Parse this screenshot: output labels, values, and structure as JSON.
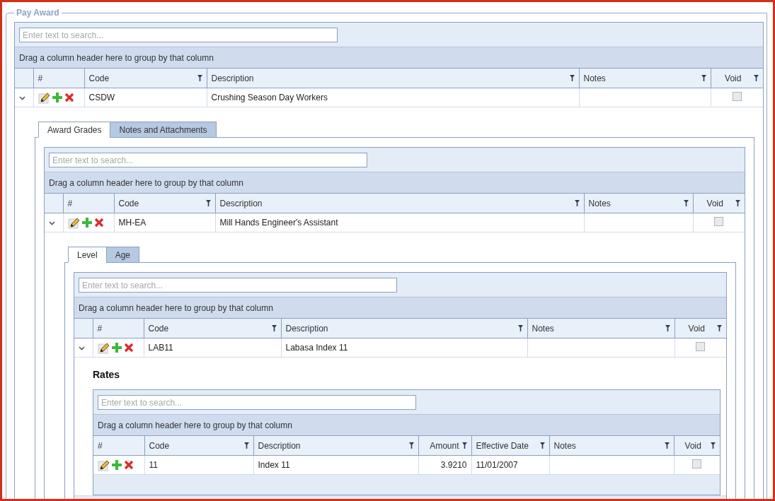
{
  "panel": {
    "legend": "Pay Award",
    "grid": {
      "search_placeholder": "Enter text to search...",
      "group_panel": "Drag a column header here to group by that column",
      "expandable": true,
      "columns": [
        {
          "label": "#",
          "kind": "actions",
          "filter": false
        },
        {
          "label": "Code",
          "kind": "text",
          "filter": true
        },
        {
          "label": "Description",
          "kind": "text",
          "filter": true
        },
        {
          "label": "Notes",
          "kind": "text",
          "filter": true
        },
        {
          "label": "Void",
          "kind": "checkbox",
          "filter": true
        }
      ],
      "rows": [
        {
          "expanded": true,
          "cells": [
            null,
            "CSDW",
            "Crushing Season Day Workers",
            null,
            {
              "checked": false
            }
          ],
          "detail": {
            "tabs": [
              {
                "label": "Award Grades",
                "selected": true
              },
              {
                "label": "Notes and Attachments",
                "selected": false
              }
            ],
            "grid": {
              "search_placeholder": "Enter text to search...",
              "group_panel": "Drag a column header here to group by that column",
              "expandable": true,
              "columns": [
                {
                  "label": "#",
                  "kind": "actions",
                  "filter": false
                },
                {
                  "label": "Code",
                  "kind": "text",
                  "filter": true
                },
                {
                  "label": "Description",
                  "kind": "text",
                  "filter": true
                },
                {
                  "label": "Notes",
                  "kind": "text",
                  "filter": true
                },
                {
                  "label": "Void",
                  "kind": "checkbox",
                  "filter": true
                }
              ],
              "rows": [
                {
                  "expanded": true,
                  "cells": [
                    null,
                    "MH-EA",
                    "Mill Hands Engineer's Assistant",
                    null,
                    {
                      "checked": false
                    }
                  ],
                  "detail": {
                    "tabs": [
                      {
                        "label": "Level",
                        "selected": true
                      },
                      {
                        "label": "Age",
                        "selected": false
                      }
                    ],
                    "grid": {
                      "search_placeholder": "Enter text to search...",
                      "group_panel": "Drag a column header here to group by that column",
                      "expandable": true,
                      "columns": [
                        {
                          "label": "#",
                          "kind": "actions",
                          "filter": false
                        },
                        {
                          "label": "Code",
                          "kind": "text",
                          "filter": true
                        },
                        {
                          "label": "Description",
                          "kind": "text",
                          "filter": true
                        },
                        {
                          "label": "Notes",
                          "kind": "text",
                          "filter": true
                        },
                        {
                          "label": "Void",
                          "kind": "checkbox",
                          "filter": true
                        }
                      ],
                      "rows": [
                        {
                          "expanded": true,
                          "cells": [
                            null,
                            "LAB11",
                            "Labasa Index 11",
                            null,
                            {
                              "checked": false
                            }
                          ],
                          "detail": {
                            "heading": "Rates",
                            "grid": {
                              "search_placeholder": "Enter text to search...",
                              "group_panel": "Drag a column header here to group by that column",
                              "expandable": false,
                              "columns": [
                                {
                                  "label": "#",
                                  "kind": "actions",
                                  "filter": false
                                },
                                {
                                  "label": "Code",
                                  "kind": "text",
                                  "filter": true
                                },
                                {
                                  "label": "Description",
                                  "kind": "text",
                                  "filter": true
                                },
                                {
                                  "label": "Amount",
                                  "kind": "number",
                                  "filter": true
                                },
                                {
                                  "label": "Effective Date",
                                  "kind": "text",
                                  "filter": true
                                },
                                {
                                  "label": "Notes",
                                  "kind": "text",
                                  "filter": true
                                },
                                {
                                  "label": "Void",
                                  "kind": "checkbox",
                                  "filter": true
                                }
                              ],
                              "rows": [
                                {
                                  "cells": [
                                    null,
                                    "11",
                                    "Index 11",
                                    "3.9210",
                                    "11/01/2007",
                                    null,
                                    {
                                      "checked": false
                                    }
                                  ]
                                }
                              ]
                            }
                          }
                        }
                      ]
                    }
                  }
                }
              ]
            }
          }
        }
      ]
    }
  }
}
